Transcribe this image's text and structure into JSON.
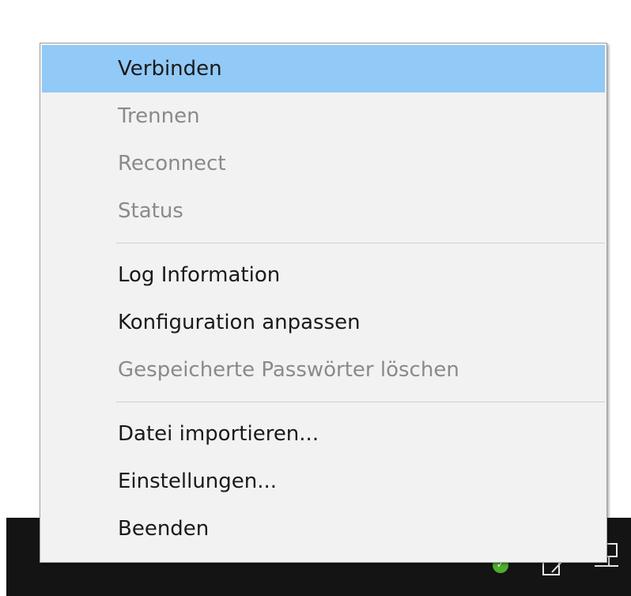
{
  "menu": {
    "items": [
      {
        "label": "Verbinden"
      },
      {
        "label": "Trennen"
      },
      {
        "label": "Reconnect"
      },
      {
        "label": "Status"
      },
      {
        "label": "Log Information"
      },
      {
        "label": "Konfiguration anpassen"
      },
      {
        "label": "Gespeicherte Passwörter löschen"
      },
      {
        "label": "Datei importieren..."
      },
      {
        "label": "Einstellungen..."
      },
      {
        "label": "Beenden"
      }
    ]
  },
  "tray": {
    "icons": [
      "checkmark-icon",
      "notes-icon",
      "network-icon"
    ],
    "check_glyph": "✓"
  },
  "colors": {
    "menu_background": "#f2f2f2",
    "highlight": "#91c9f7",
    "disabled_text": "#8a8a8a",
    "taskbar": "#141414",
    "status_ok": "#4caf2c"
  }
}
